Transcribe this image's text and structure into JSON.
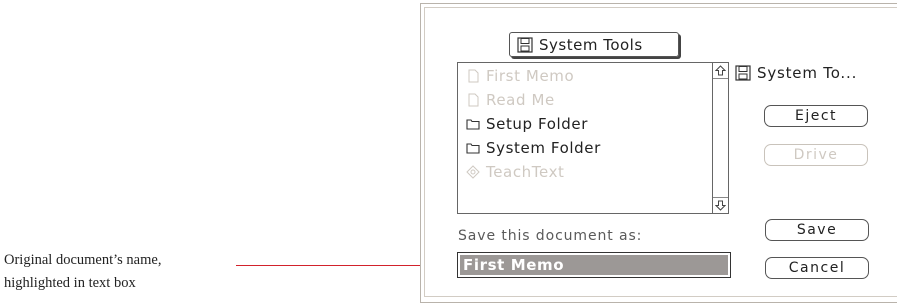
{
  "callout": {
    "line1": "Original document’s name,",
    "line2": "highlighted in text box"
  },
  "dialog": {
    "folder_popup": {
      "label": "System Tools",
      "icon": "disk-icon"
    },
    "file_list": {
      "items": [
        {
          "label": "First Memo",
          "icon": "document-icon",
          "enabled": false
        },
        {
          "label": "Read Me",
          "icon": "document-icon",
          "enabled": false
        },
        {
          "label": "Setup Folder",
          "icon": "folder-icon",
          "enabled": true
        },
        {
          "label": "System Folder",
          "icon": "folder-icon",
          "enabled": true
        },
        {
          "label": "TeachText",
          "icon": "application-icon",
          "enabled": false
        }
      ]
    },
    "volume": {
      "label": "System To...",
      "icon": "disk-icon"
    },
    "buttons": {
      "eject": "Eject",
      "drive": "Drive",
      "save": "Save",
      "cancel": "Cancel"
    },
    "prompt": "Save this document as:",
    "name_field": {
      "value": "First Memo",
      "selected": true
    }
  },
  "colors": {
    "leader_line": "#d2222c",
    "selection": "#9c9896",
    "disabled_text": "#cfc9c2"
  }
}
